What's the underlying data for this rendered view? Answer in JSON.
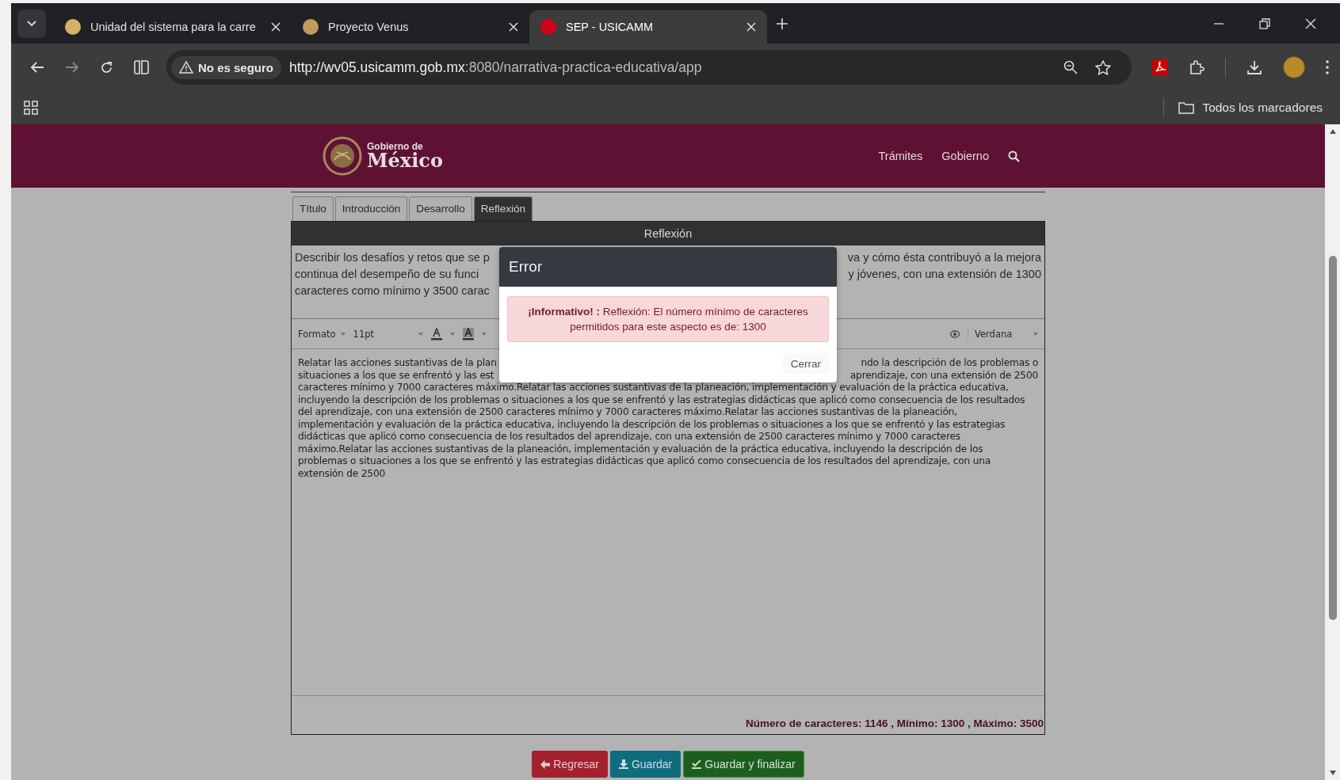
{
  "browser": {
    "tabs": [
      {
        "title": "Unidad del sistema para la carre",
        "selected": false,
        "color": "#d4b06a"
      },
      {
        "title": "Proyecto Venus",
        "selected": false,
        "color": "#c49a5c"
      },
      {
        "title": "SEP - USICAMM",
        "selected": true,
        "color": "#d0021b"
      }
    ],
    "security": "No es seguro",
    "url_host": "http://wv05.usicamm.gob.mx",
    "url_rest": ":8080/narrativa-practica-educativa/app",
    "bookmarks": "Todos los marcadores"
  },
  "header": {
    "logo_small": "Gobierno de",
    "logo_big": "México",
    "nav": [
      "Trámites",
      "Gobierno"
    ]
  },
  "section_tabs": [
    {
      "label": "Título",
      "selected": false
    },
    {
      "label": "Introducción",
      "selected": false
    },
    {
      "label": "Desarrollo",
      "selected": false
    },
    {
      "label": "Reflexión",
      "selected": true
    }
  ],
  "panel": {
    "title": "Reflexión",
    "description_lines": [
      {
        "left": "Describir los desafíos y retos que se p",
        "right": "va y cómo ésta contribuyó a la mejora"
      },
      {
        "left": "continua del desempeño de su funci",
        "right": "y jóvenes, con una extensión de 1300"
      },
      {
        "left": "caracteres como mínimo y 3500 carac"
      }
    ],
    "toolbar": {
      "format": "Formato",
      "size": "11pt",
      "font": "Verdana"
    },
    "editor_lines": [
      {
        "left": "Relatar las acciones sustantivas de la plan",
        "right": "ndo la descripción de los problemas o"
      },
      {
        "left": "situaciones a los que se enfrentó y las est",
        "right": "aprendizaje, con una extensión de 2500"
      },
      {
        "left": "caracteres mínimo y 7000 caracteres máximo.Relatar las acciones sustantivas de la planeación, implementación y evaluación de la práctica educativa,"
      },
      {
        "left": "incluyendo la descripción de los problemas o situaciones a los que se enfrentó y las estrategias didácticas que aplicó como consecuencia de los resultados"
      },
      {
        "left": "del aprendizaje, con una extensión de 2500 caracteres mínimo y 7000 caracteres máximo.Relatar las acciones sustantivas de la planeación,"
      },
      {
        "left": "implementación y evaluación de la práctica educativa, incluyendo la descripción de los problemas o situaciones a los que se enfrentó y las estrategias"
      },
      {
        "left": "didácticas que aplicó como consecuencia de los resultados del aprendizaje, con una extensión de 2500 caracteres mínimo y 7000 caracteres"
      },
      {
        "left": "máximo.Relatar las acciones sustantivas de la planeación, implementación y evaluación de la práctica educativa, incluyendo la descripción de los"
      },
      {
        "left": "problemas o situaciones a los que se enfrentó y las estrategias didácticas que aplicó como consecuencia de los resultados del aprendizaje, con una"
      },
      {
        "left": "extensión de 2500"
      }
    ],
    "counter": "Número de caracteres: 1146 , Mínimo: 1300 , Máximo: 3500"
  },
  "buttons": [
    {
      "label": "Regresar",
      "kind": "back"
    },
    {
      "label": "Guardar",
      "kind": "save"
    },
    {
      "label": "Guardar y finalizar",
      "kind": "finish"
    }
  ],
  "dialog": {
    "title": "Error",
    "message": "**¡Informativo! :** Reflexión: El número mínimo de caracteres permitidos para este aspecto es de: 1300",
    "close": "Cerrar"
  }
}
